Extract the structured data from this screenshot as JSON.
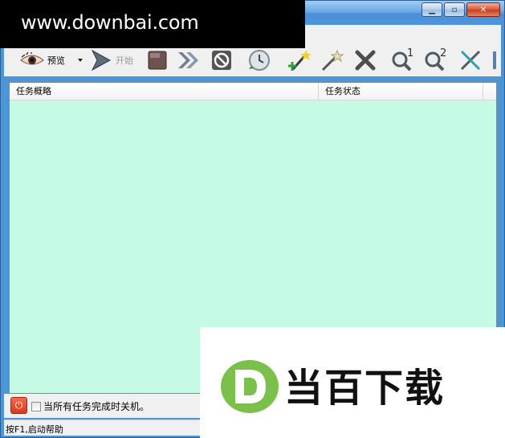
{
  "watermark": {
    "top_text": "www.downbai.com",
    "logo_text": "当百下载",
    "logo_letter": "D"
  },
  "window": {
    "controls": [
      "minimize",
      "maximize",
      "close"
    ]
  },
  "toolbar": {
    "preview_label": "预览",
    "start_label": "开始",
    "icons": [
      "eye-icon",
      "dropdown-arrow-icon",
      "play-icon",
      "stop-icon",
      "fast-forward-icon",
      "cancel-icon",
      "clock-icon",
      "add-task-icon",
      "wand-icon",
      "delete-icon",
      "search-1-icon",
      "search-2-icon",
      "tools-icon"
    ]
  },
  "list": {
    "columns": [
      "任务概略",
      "任务状态"
    ],
    "rows": [],
    "background": "#c5fbe5"
  },
  "bottom": {
    "shutdown_label": "当所有任务完成时关机。",
    "shutdown_checked": false
  },
  "status": {
    "text": "按F1,启动帮助"
  },
  "colors": {
    "accent": "#4a96d8",
    "list_bg": "#c5fbe5",
    "close_red": "#c63a1d",
    "logo_green": "#7ac04a"
  }
}
